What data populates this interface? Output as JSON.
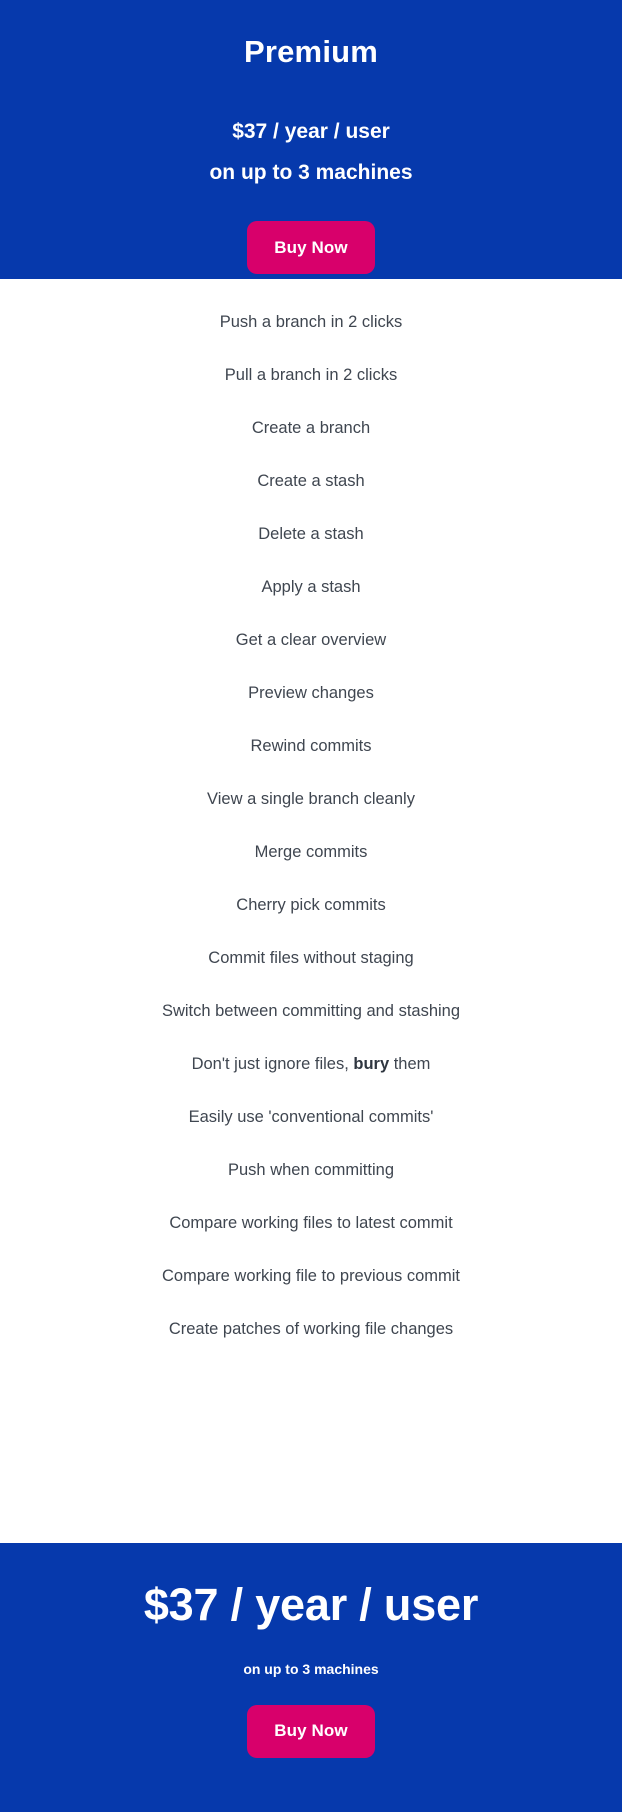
{
  "header": {
    "plan_name": "Premium",
    "price_lines": [
      "$37 / year / user",
      "on up to 3 machines"
    ],
    "buy_label": "Buy Now",
    "background_color": "#0639AC",
    "accent_color": "#D8006B"
  },
  "features": [
    {
      "text": "Push a branch in 2 clicks"
    },
    {
      "text": "Pull a branch in 2 clicks"
    },
    {
      "text": "Create a branch"
    },
    {
      "text": "Create a stash"
    },
    {
      "text": "Delete a stash"
    },
    {
      "text": "Apply a stash"
    },
    {
      "text": "Get a clear overview"
    },
    {
      "text": "Preview changes"
    },
    {
      "text": "Rewind commits"
    },
    {
      "text": "View a single branch cleanly"
    },
    {
      "text": "Merge commits"
    },
    {
      "text": "Cherry pick commits"
    },
    {
      "text": "Commit files without staging"
    },
    {
      "text": "Switch between committing and stashing"
    },
    {
      "text": "Don't just ignore files, bury them",
      "bold_part": "bury",
      "prefix": "Don't just ignore files, ",
      "suffix": " them"
    },
    {
      "text": "Easily use 'conventional commits'"
    },
    {
      "text": "Push when committing"
    },
    {
      "text": "Compare working files to latest commit"
    },
    {
      "text": "Compare working file to previous commit"
    },
    {
      "text": "Create patches of working file changes"
    }
  ],
  "footer": {
    "price": "$37 / year / user",
    "subtitle": "on up to 3 machines",
    "buy_label": "Buy Now",
    "background_color": "#0639AC",
    "accent_color": "#D8006B"
  }
}
